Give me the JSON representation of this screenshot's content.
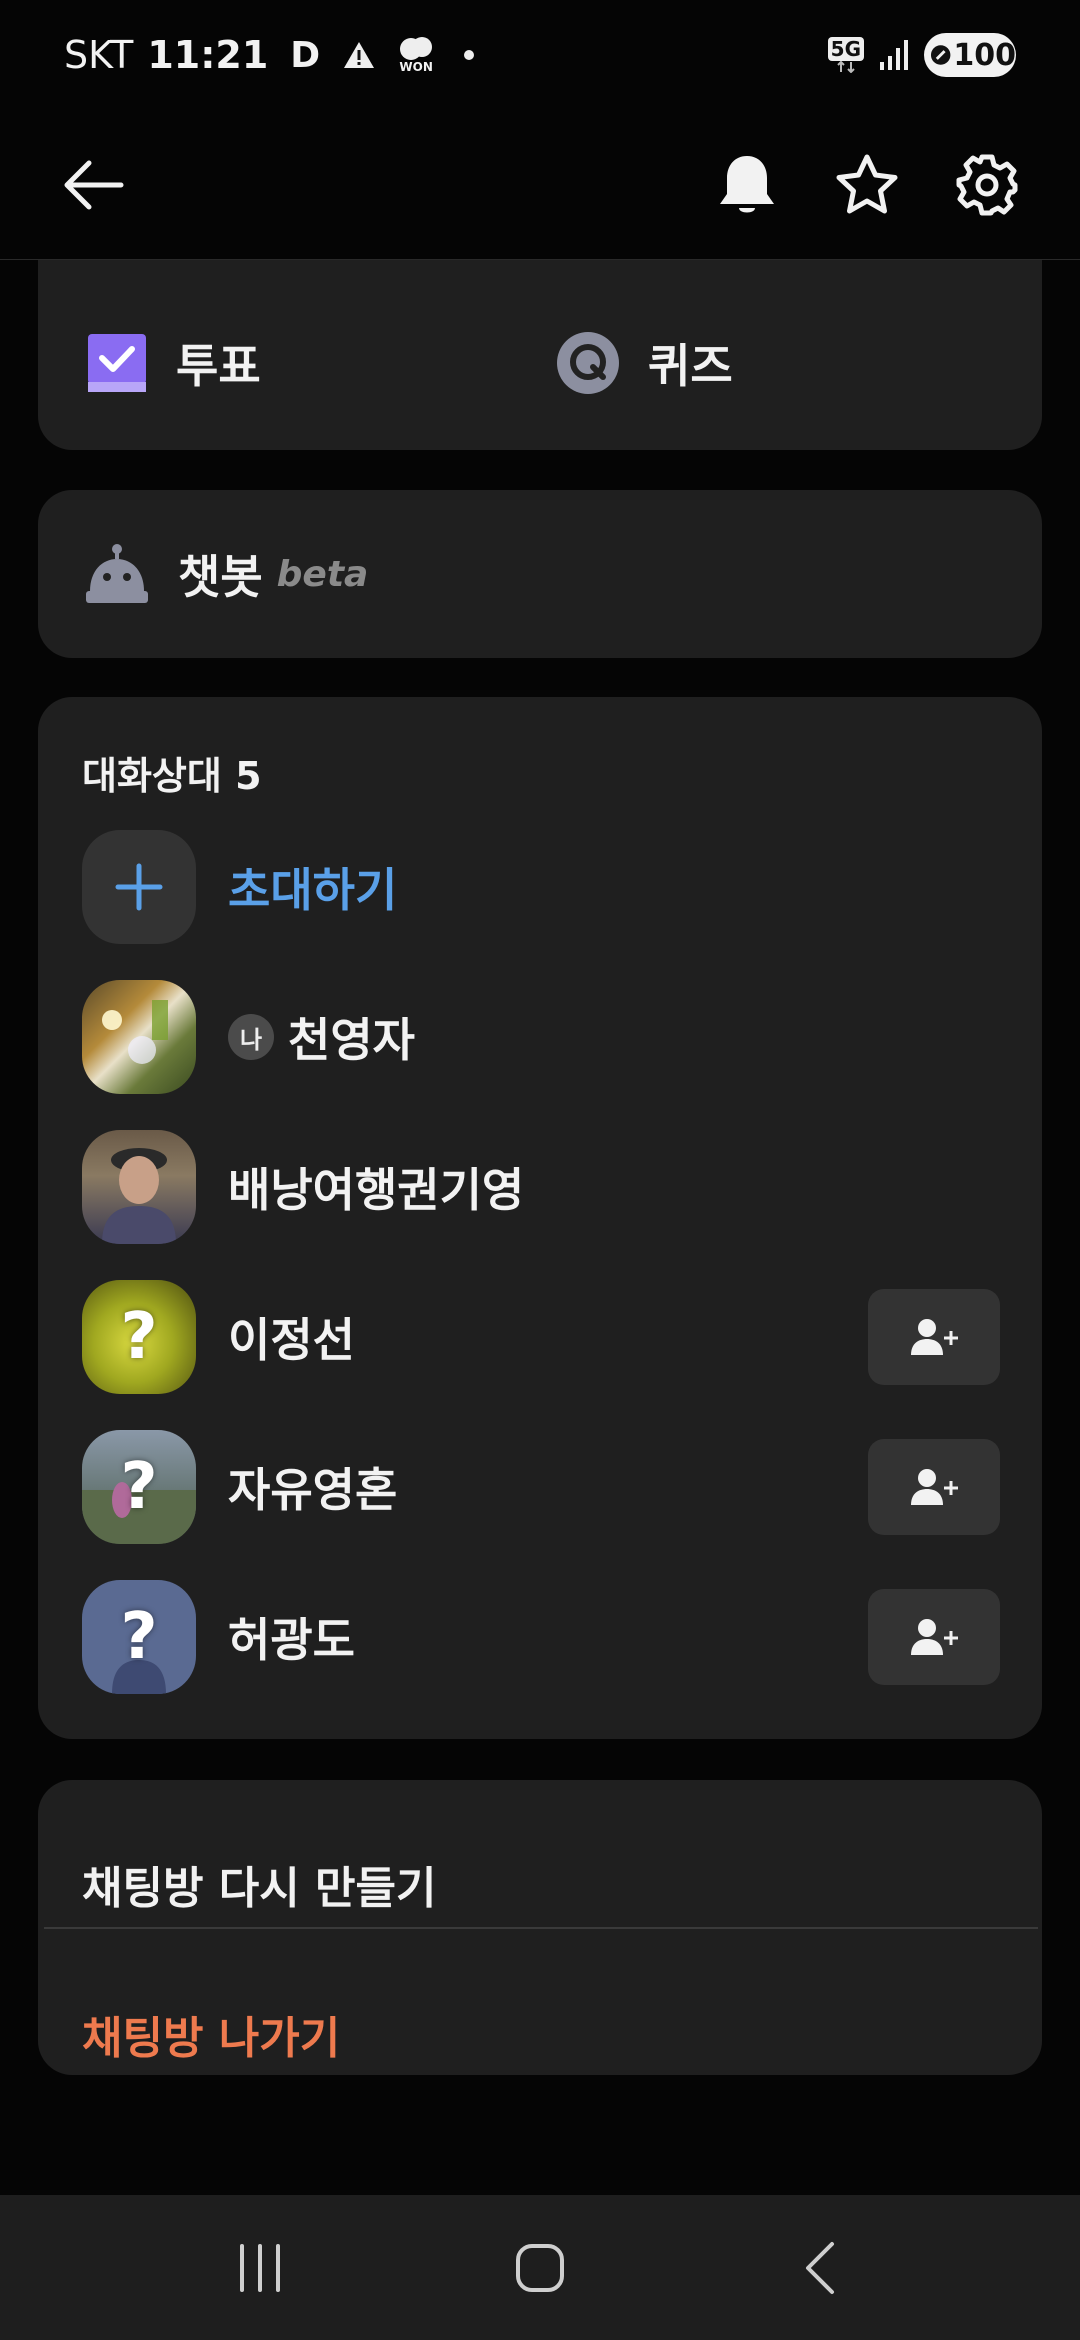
{
  "status_bar": {
    "carrier": "SKT",
    "time": "11:21",
    "d_icon": "D",
    "won_label": "WON",
    "network": "5G",
    "battery": "100"
  },
  "app_bar": {
    "back_icon": "arrow-left-icon",
    "icons": [
      "bell-icon",
      "star-icon",
      "gear-icon"
    ]
  },
  "features": {
    "vote": "투표",
    "quiz": "퀴즈"
  },
  "chatbot": {
    "label": "챗봇",
    "beta": "beta"
  },
  "members": {
    "title": "대화상대 5",
    "invite_label": "초대하기",
    "me_badge": "나",
    "list": [
      {
        "name": "천영자",
        "is_me": true
      },
      {
        "name": "배낭여행권기영",
        "is_me": false
      },
      {
        "name": "이정선",
        "is_me": false,
        "unknown": true
      },
      {
        "name": "자유영혼",
        "is_me": false,
        "unknown": true
      },
      {
        "name": "허광도",
        "is_me": false,
        "unknown": true
      }
    ],
    "unknown_mark": "?"
  },
  "actions": {
    "recreate": "채팅방 다시 만들기",
    "leave": "채팅방 나가기"
  },
  "colors": {
    "accent_blue": "#5aa0e8",
    "danger_orange": "#ee7a4e",
    "vote_purple": "#8a6cf2",
    "card_bg": "#1f1f1f"
  }
}
